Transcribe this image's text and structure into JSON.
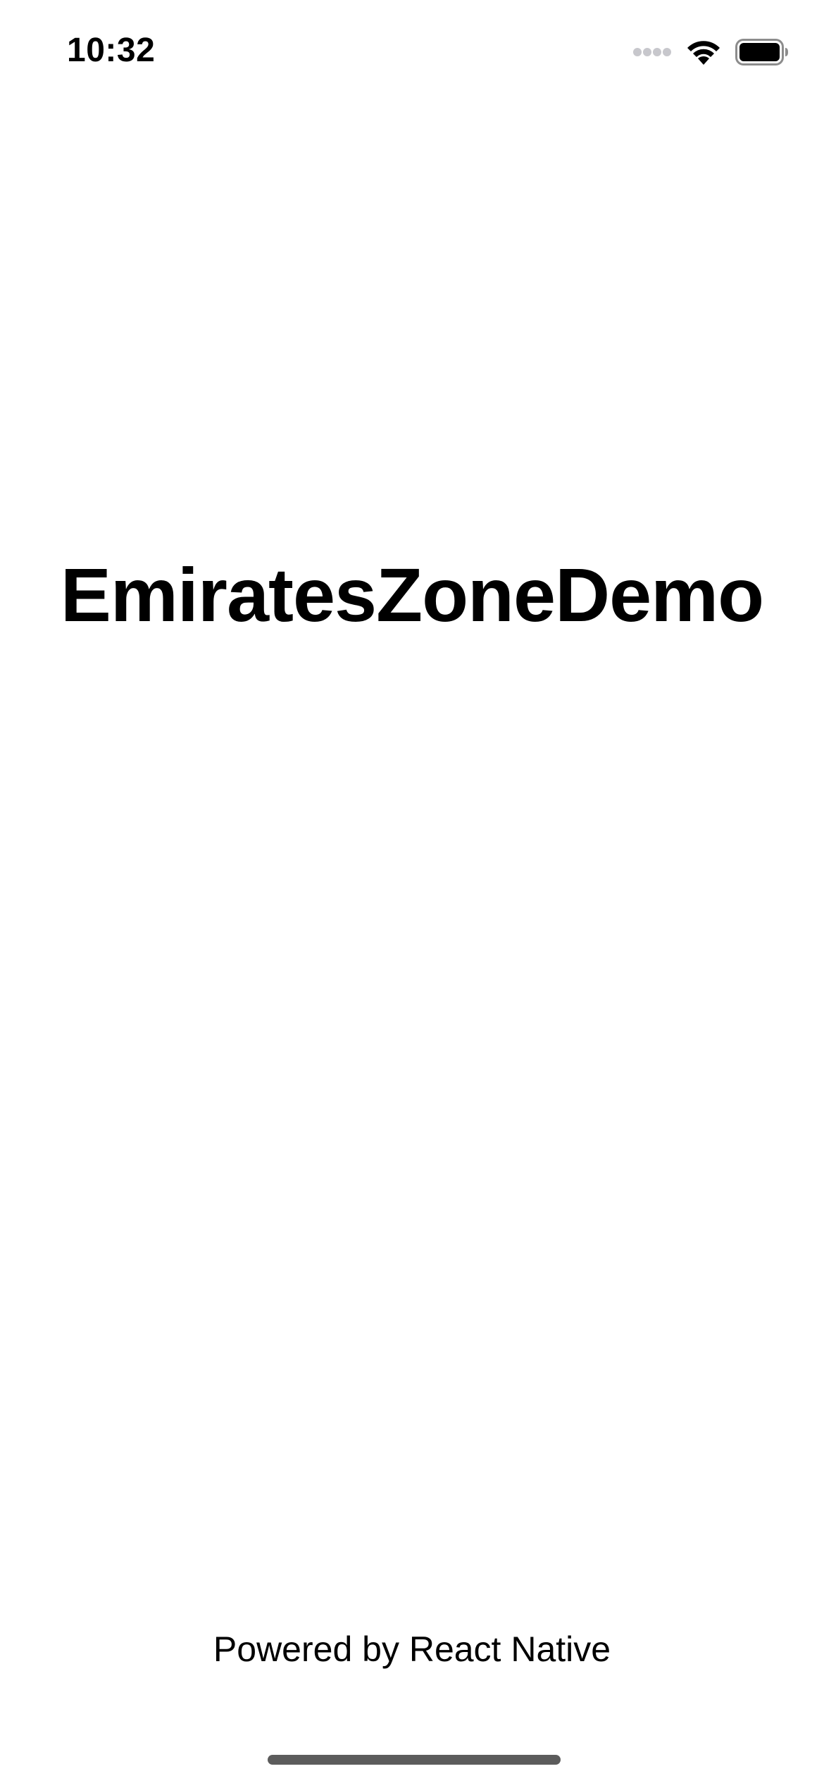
{
  "status_bar": {
    "time": "10:32",
    "icons": [
      "cellular-signal-icon",
      "wifi-icon",
      "battery-icon"
    ]
  },
  "main": {
    "title": "EmiratesZoneDemo"
  },
  "footer": {
    "text": "Powered by React Native"
  },
  "colors": {
    "background": "#ffffff",
    "text": "#000000",
    "inactive_signal": "#c7c7cc",
    "home_indicator": "#5c5c5c"
  }
}
